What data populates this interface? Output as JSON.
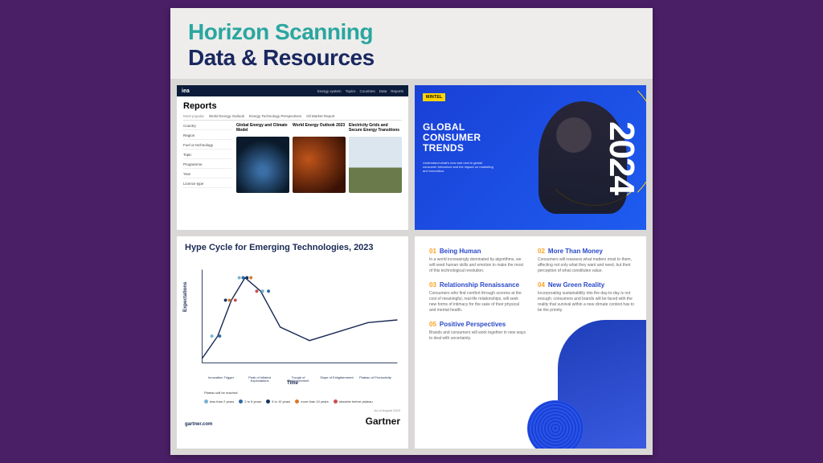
{
  "header": {
    "line1": "Horizon Scanning",
    "line2": "Data & Resources"
  },
  "iea": {
    "logo": "iea",
    "nav": [
      "Energy system",
      "Topics",
      "Countries",
      "Data",
      "Reports"
    ],
    "title": "Reports",
    "tab_label": "Most popular",
    "tabs": [
      "World Energy Outlook",
      "Energy Technology Perspectives",
      "Oil Market Report"
    ],
    "filters": [
      "Country",
      "Region",
      "Fuel or technology",
      "Topic",
      "Programme",
      "Year",
      "Licence type"
    ],
    "reports": [
      {
        "title": "Global Energy and Climate Model"
      },
      {
        "title": "World Energy Outlook 2023"
      },
      {
        "title": "Electricity Grids and Secure Energy Transitions"
      }
    ]
  },
  "mintel": {
    "badge": "MINTEL",
    "title1": "GLOBAL",
    "title2": "CONSUMER",
    "title3": "TRENDS",
    "sub": "Understand what's new and next in global consumer behaviour and the impact on marketing and innovation.",
    "year": "2024"
  },
  "gartner": {
    "title": "Hype Cycle for Emerging Technologies, 2023",
    "ylabel": "Expectations",
    "xlabel": "Time",
    "phases": [
      "Innovation Trigger",
      "Peak of Inflated Expectations",
      "Trough of Disillusionment",
      "Slope of Enlightenment",
      "Plateau of Productivity"
    ],
    "legend_label": "Plateau will be reached:",
    "legend": [
      {
        "label": "less than 2 years",
        "color": "#7bb3d1"
      },
      {
        "label": "2 to 5 years",
        "color": "#2e6ca4"
      },
      {
        "label": "5 to 10 years",
        "color": "#14365e"
      },
      {
        "label": "more than 10 years",
        "color": "#d9762b"
      },
      {
        "label": "obsolete before plateau",
        "color": "#c94f4f"
      }
    ],
    "asof": "As of August 2023",
    "url": "gartner.com",
    "brand": "Gartner"
  },
  "trends": {
    "items": [
      {
        "num": "01",
        "name": "Being Human",
        "desc": "In a world increasingly dominated by algorithms, we will need human skills and emotion to make the most of this technological revolution."
      },
      {
        "num": "02",
        "name": "More Than Money",
        "desc": "Consumers will reassess what matters most to them, affecting not only what they want and need, but their perception of what constitutes value."
      },
      {
        "num": "03",
        "name": "Relationship Renaissance",
        "desc": "Consumers who find comfort through screens at the cost of meaningful, real-life relationships, will seek new forms of intimacy for the sake of their physical and mental health."
      },
      {
        "num": "04",
        "name": "New Green Reality",
        "desc": "Incorporating sustainability into the day-to-day is not enough; consumers and brands will be faced with the reality that survival within a new climate context has to be the priority."
      },
      {
        "num": "05",
        "name": "Positive Perspectives",
        "desc": "Brands and consumers will work together in new ways to deal with uncertainty."
      }
    ]
  },
  "chart_data": {
    "type": "line",
    "title": "Hype Cycle for Emerging Technologies, 2023",
    "xlabel": "Time",
    "ylabel": "Expectations",
    "phases": [
      "Innovation Trigger",
      "Peak of Inflated Expectations",
      "Trough of Disillusionment",
      "Slope of Enlightenment",
      "Plateau of Productivity"
    ],
    "curve": [
      {
        "x": 0.0,
        "y": 0.05
      },
      {
        "x": 0.08,
        "y": 0.3
      },
      {
        "x": 0.15,
        "y": 0.7
      },
      {
        "x": 0.22,
        "y": 0.95
      },
      {
        "x": 0.3,
        "y": 0.8
      },
      {
        "x": 0.4,
        "y": 0.4
      },
      {
        "x": 0.55,
        "y": 0.25
      },
      {
        "x": 0.7,
        "y": 0.35
      },
      {
        "x": 0.85,
        "y": 0.45
      },
      {
        "x": 1.0,
        "y": 0.48
      }
    ]
  }
}
